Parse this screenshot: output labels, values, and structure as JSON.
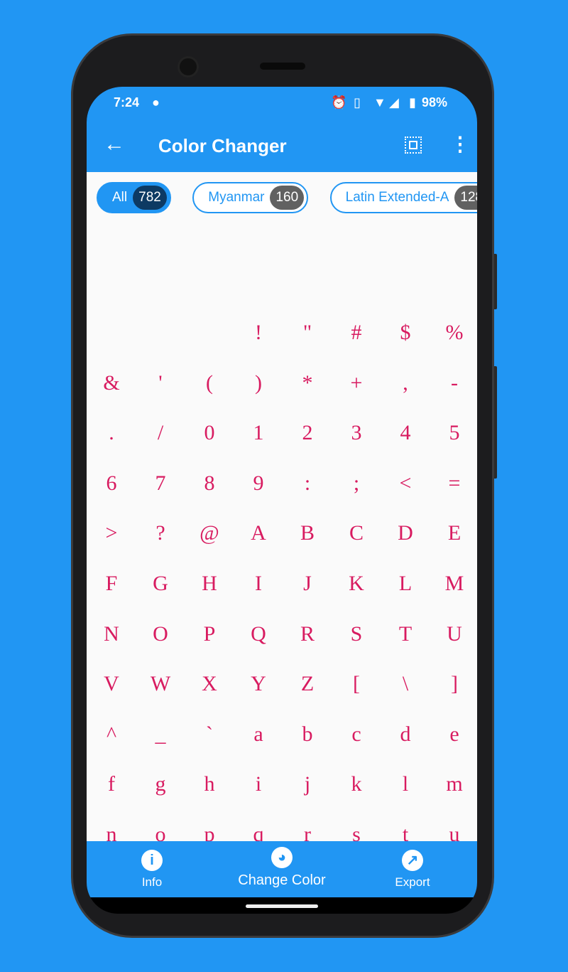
{
  "status": {
    "time": "7:24",
    "battery": "98%",
    "icons": [
      "alarm-icon",
      "vibrate-icon",
      "wifi-icon",
      "signal-icon",
      "battery-icon"
    ]
  },
  "appbar": {
    "title": "Color Changer",
    "back_icon": "arrow-left-icon",
    "select_icon": "select-all-icon",
    "more_icon": "more-vert-icon"
  },
  "chips": [
    {
      "label": "All",
      "count": "782",
      "active": true
    },
    {
      "label": "Myanmar",
      "count": "160",
      "active": false
    },
    {
      "label": "Latin Extended-A",
      "count": "128",
      "active": false
    }
  ],
  "glyph_color": "#d81b60",
  "accent": "#2196f3",
  "glyphs": [
    " ",
    " ",
    " ",
    "!",
    "\"",
    "#",
    "$",
    "%",
    "&",
    "'",
    "(",
    ")",
    "*",
    "+",
    ",",
    "-",
    ".",
    "/",
    "0",
    "1",
    "2",
    "3",
    "4",
    "5",
    "6",
    "7",
    "8",
    "9",
    ":",
    ";",
    "<",
    "=",
    ">",
    "?",
    "@",
    "A",
    "B",
    "C",
    "D",
    "E",
    "F",
    "G",
    "H",
    "I",
    "J",
    "K",
    "L",
    "M",
    "N",
    "O",
    "P",
    "Q",
    "R",
    "S",
    "T",
    "U",
    "V",
    "W",
    "X",
    "Y",
    "Z",
    "[",
    "\\",
    "]",
    "^",
    "_",
    "`",
    "a",
    "b",
    "c",
    "d",
    "e",
    "f",
    "g",
    "h",
    "i",
    "j",
    "k",
    "l",
    "m",
    "n",
    "o",
    "p",
    "q",
    "r",
    "s",
    "t",
    "u",
    "v",
    "w",
    "x",
    "y",
    "z",
    "{",
    "|",
    "}",
    "~",
    " ",
    "¡",
    "¢",
    "£",
    "¤",
    "¥",
    "¦"
  ],
  "bottom_nav": [
    {
      "label": "Info",
      "icon": "info-icon"
    },
    {
      "label": "Change Color",
      "icon": "palette-icon"
    },
    {
      "label": "Export",
      "icon": "export-icon"
    }
  ]
}
